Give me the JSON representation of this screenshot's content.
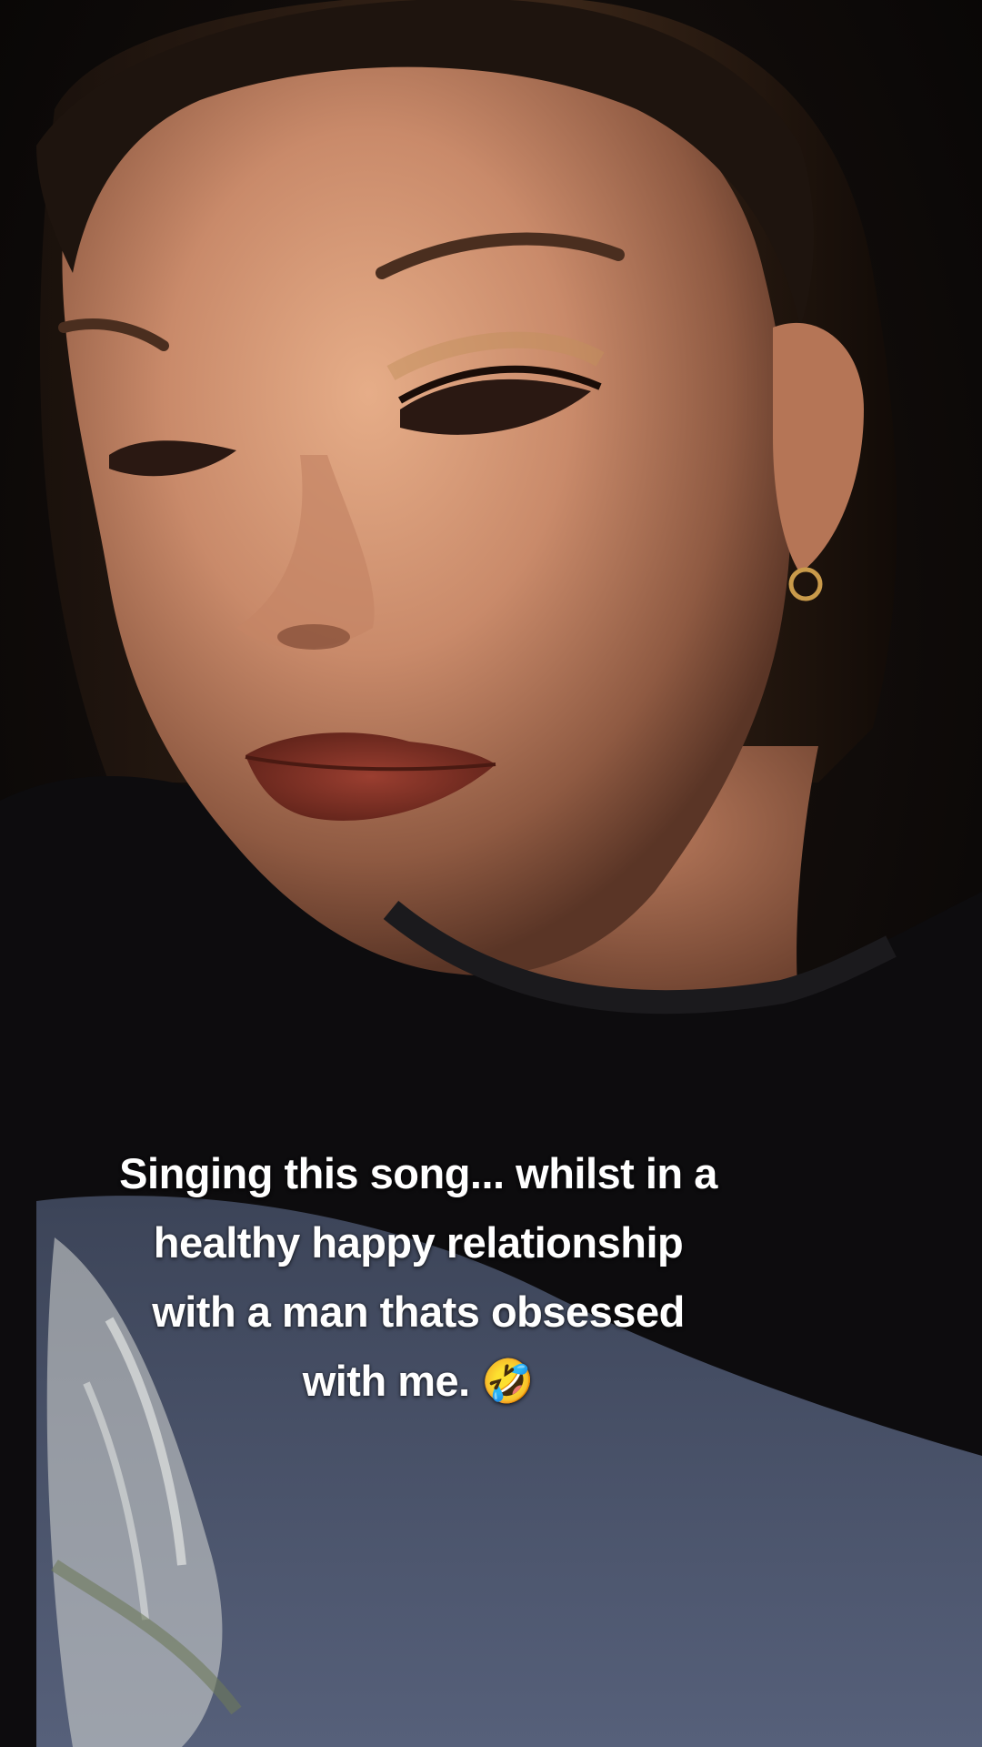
{
  "caption": {
    "text": "Singing this song... whilst in a\nhealthy happy relationship\nwith a man thats obsessed\nwith me. 🤣"
  },
  "colors": {
    "background": "#0b0807",
    "shirt": "#0d0c0e",
    "shirt_print": "#49516a",
    "skin": "#c98a6a",
    "hair": "#2a1b12",
    "lips": "#7a2f24",
    "caption_text": "#ffffff"
  }
}
